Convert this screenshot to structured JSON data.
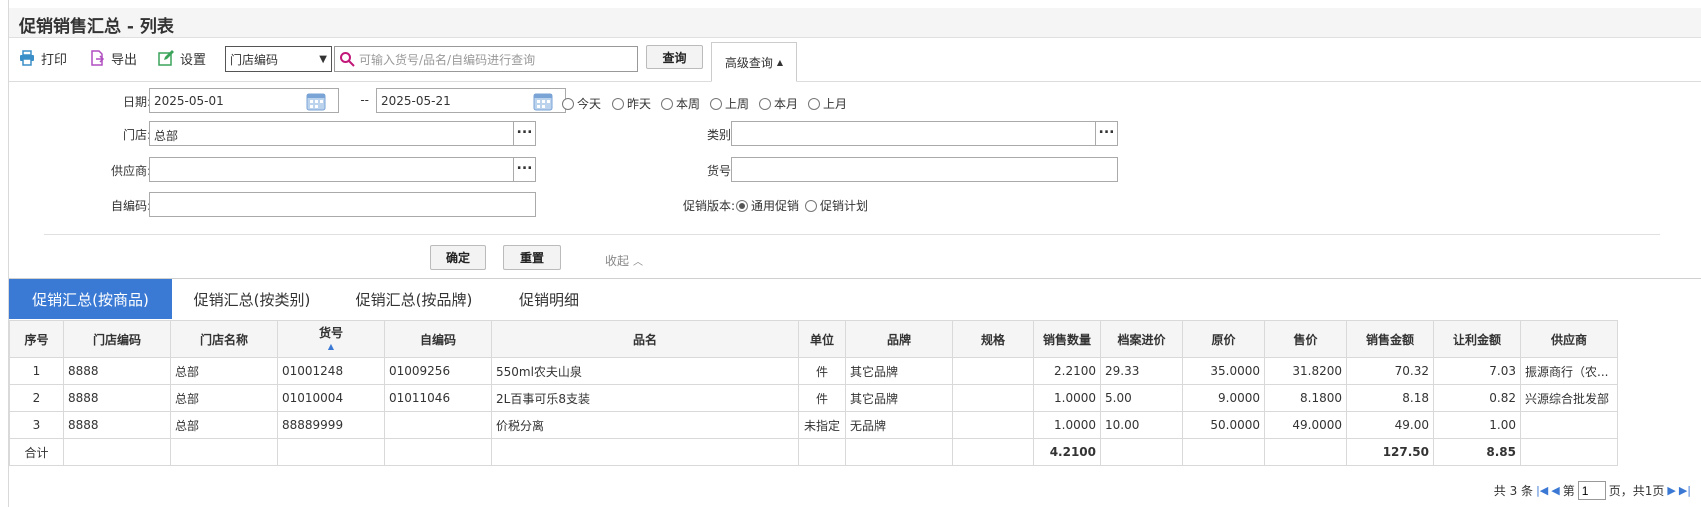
{
  "title": "促销销售汇总 - 列表",
  "toolbar": {
    "print": "打印",
    "export": "导出",
    "settings": "设置",
    "store_select": "门店编码",
    "search_placeholder": "可输入货号/品名/自编码进行查询",
    "query": "查询",
    "advanced": "高级查询"
  },
  "form": {
    "date_label": "日期:",
    "date_from": "2025-05-01",
    "date_sep": "--",
    "date_to": "2025-05-21",
    "ranges": [
      "今天",
      "昨天",
      "本周",
      "上周",
      "本月",
      "上月"
    ],
    "store_label": "门店:",
    "store_value": "总部",
    "category_label": "类别:",
    "category_value": "",
    "supplier_label": "供应商:",
    "supplier_value": "",
    "item_no_label": "货号:",
    "item_no_value": "",
    "self_code_label": "自编码:",
    "self_code_value": "",
    "promo_version_label": "促销版本:",
    "promo_general": "通用促销",
    "promo_plan": "促销计划",
    "confirm": "确定",
    "reset": "重置",
    "collapse": "收起"
  },
  "tabs": [
    "促销汇总(按商品)",
    "促销汇总(按类别)",
    "促销汇总(按品牌)",
    "促销明细"
  ],
  "table": {
    "headers": [
      "序号",
      "门店编码",
      "门店名称",
      "货号",
      "自编码",
      "品名",
      "单位",
      "品牌",
      "规格",
      "销售数量",
      "档案进价",
      "原价",
      "售价",
      "销售金额",
      "让利金额",
      "供应商"
    ],
    "rows": [
      [
        "1",
        "8888",
        "总部",
        "01001248",
        "01009256",
        "550ml农夫山泉",
        "件",
        "其它品牌",
        "",
        "2.2100",
        "29.33",
        "35.0000",
        "31.8200",
        "70.32",
        "7.03",
        "振源商行（农..."
      ],
      [
        "2",
        "8888",
        "总部",
        "01010004",
        "01011046",
        "2L百事可乐8支装",
        "件",
        "其它品牌",
        "",
        "1.0000",
        "5.00",
        "9.0000",
        "8.1800",
        "8.18",
        "0.82",
        "兴源综合批发部"
      ],
      [
        "3",
        "8888",
        "总部",
        "88889999",
        "",
        "价税分离",
        "未指定",
        "无品牌",
        "",
        "1.0000",
        "10.00",
        "50.0000",
        "49.0000",
        "49.00",
        "1.00",
        ""
      ]
    ],
    "total": [
      "合计",
      "",
      "",
      "",
      "",
      "",
      "",
      "",
      "",
      "4.2100",
      "",
      "",
      "",
      "127.50",
      "8.85",
      ""
    ]
  },
  "pager": {
    "total_text": "共 3 条",
    "page_prefix": "第",
    "page": "1",
    "page_suffix": "页，共1页"
  },
  "colors": {
    "accent": "#3b7ad4",
    "print_icon": "#3a8fc9",
    "export_icon": "#b04fc0",
    "settings_icon": "#3aa35a",
    "search_icon": "#c2187a"
  }
}
